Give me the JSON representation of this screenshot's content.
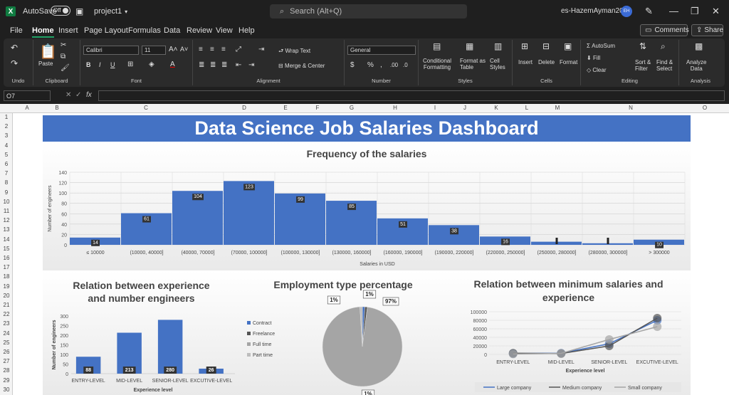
{
  "titlebar": {
    "autosave": "AutoSave",
    "toggle": "Off",
    "doc": "project1",
    "search": "Search (Alt+Q)",
    "user": "es-HazemAyman2022",
    "initials": "EH"
  },
  "menu": [
    "File",
    "Home",
    "Insert",
    "Page Layout",
    "Formulas",
    "Data",
    "Review",
    "View",
    "Help"
  ],
  "buttons": {
    "comments": "Comments",
    "share": "Share"
  },
  "ribbon": {
    "undo": "Undo",
    "clipboard": "Clipboard",
    "paste": "Paste",
    "font": "Font",
    "font_name": "Calibri",
    "font_size": "11",
    "alignment": "Alignment",
    "wrap": "Wrap Text",
    "merge": "Merge & Center",
    "number": "Number",
    "number_format": "General",
    "styles": "Styles",
    "cond_a": "Conditional",
    "cond_b": "Formatting",
    "fmt_a": "Format as",
    "fmt_b": "Table",
    "cell_a": "Cell",
    "cell_b": "Styles",
    "cells": "Cells",
    "insert": "Insert",
    "delete": "Delete",
    "format": "Format",
    "editing": "Editing",
    "autosum": "AutoSum",
    "fill": "Fill",
    "clear": "Clear",
    "sort_a": "Sort &",
    "sort_b": "Filter",
    "find_a": "Find &",
    "find_b": "Select",
    "analysis": "Analysis",
    "analyze_a": "Analyze",
    "analyze_b": "Data"
  },
  "formula_bar": {
    "namebox": "O7",
    "fx": "fx"
  },
  "columns": [
    "A",
    "B",
    "C",
    "D",
    "E",
    "F",
    "G",
    "H",
    "I",
    "J",
    "K",
    "L",
    "M",
    "N",
    "O"
  ],
  "rows": [
    "1",
    "2",
    "3",
    "4",
    "5",
    "6",
    "7",
    "8",
    "9",
    "10",
    "11",
    "12",
    "13",
    "14",
    "15",
    "16",
    "17",
    "18",
    "19",
    "20",
    "21",
    "22",
    "23",
    "24",
    "25",
    "26",
    "27",
    "28",
    "29",
    "30"
  ],
  "dashboard_title": "Data Science Job Salaries Dashboard",
  "chart_data": [
    {
      "type": "bar",
      "title": "Frequency of the salaries",
      "xlabel": "Salaries in USD",
      "ylabel": "Number of engineers",
      "categories": [
        "≤ 10000",
        "(10000, 40000]",
        "(40000, 70000]",
        "(70000, 100000]",
        "(100000, 130000]",
        "(130000, 160000]",
        "(160000, 190000]",
        "(190000, 220000]",
        "(220000, 250000]",
        "(250000, 280000]",
        "(280000, 300000]",
        "> 300000"
      ],
      "values": [
        14,
        61,
        104,
        123,
        99,
        85,
        51,
        38,
        16,
        6,
        3,
        10
      ],
      "data_labels": [
        "14",
        "61",
        "104",
        "123",
        "99",
        "85",
        "51",
        "38",
        "16",
        "",
        "",
        "10"
      ],
      "ylim": [
        0,
        140
      ],
      "yticks": [
        "0",
        "20",
        "40",
        "60",
        "80",
        "100",
        "120",
        "140"
      ],
      "color": "#4472c4",
      "grid": true
    },
    {
      "type": "bar",
      "title_a": "Relation between experience",
      "title_b": "and number engineers",
      "xlabel": "Experience level",
      "ylabel": "Number of engineers",
      "categories": [
        "ENTRY-LEVEL",
        "MID-LEVEL",
        "SENIOR-LEVEL",
        "EXCUTIVE-LEVEL"
      ],
      "values": [
        88,
        213,
        280,
        26
      ],
      "data_labels": [
        "88",
        "213",
        "280",
        "26"
      ],
      "ylim": [
        0,
        300
      ],
      "yticks": [
        "0",
        "50",
        "100",
        "150",
        "200",
        "250",
        "300"
      ],
      "color": "#4472c4"
    },
    {
      "type": "pie",
      "title": "Employment type percentage",
      "labels": [
        "Contract",
        "Freelance",
        "Full time",
        "Part time"
      ],
      "values": [
        1,
        1,
        97,
        1
      ],
      "data_labels": [
        "1%",
        "1%",
        "97%",
        "1%"
      ],
      "colors": [
        "#4472c4",
        "#555555",
        "#a5a5a5",
        "#bdbdbd"
      ],
      "legend": "left"
    },
    {
      "type": "line",
      "title_a": "Relation between minimum salaries and",
      "title_b": "experience",
      "xlabel": "Experience level",
      "categories": [
        "ENTRY-LEVEL",
        "MID-LEVEL",
        "SENIOR-LEVEL",
        "EXCUTIVE-LEVEL"
      ],
      "series": [
        {
          "name": "Large company",
          "values": [
            2000,
            3000,
            25000,
            80000
          ],
          "color": "#4472c4"
        },
        {
          "name": "Medium company",
          "values": [
            3000,
            2000,
            20000,
            85000
          ],
          "color": "#555555"
        },
        {
          "name": "Small company",
          "values": [
            1000,
            2500,
            35000,
            65000
          ],
          "color": "#a5a5a5"
        }
      ],
      "ylim": [
        0,
        100000
      ],
      "yticks": [
        "0",
        "20000",
        "40000",
        "60000",
        "80000",
        "100000"
      ],
      "legend": "bottom"
    }
  ]
}
